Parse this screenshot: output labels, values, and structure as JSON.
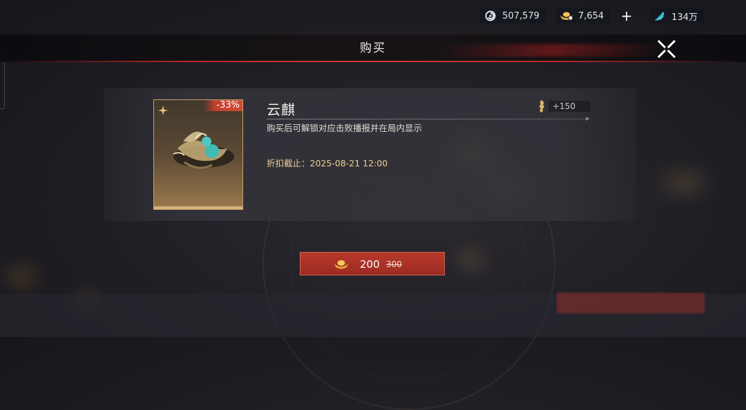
{
  "header": {
    "title": "购买",
    "currencies": [
      {
        "icon": "spiral-coin-icon",
        "value": "507,579"
      },
      {
        "icon": "gold-ingot-icon",
        "value": "7,654"
      },
      {
        "icon": "feather-icon",
        "value": "134万"
      }
    ]
  },
  "item": {
    "name": "云麒",
    "discount": "-33%",
    "bonus": "+150",
    "description": "购买后可解锁对应击败播报并在局内显示",
    "deadline": "折扣截止：2025-08-21 12:00"
  },
  "purchase": {
    "price": "200",
    "original_price": "300"
  },
  "colors": {
    "accent_red": "#b8392c",
    "gold_text": "#eccf95",
    "card_border": "#c7a56a"
  }
}
